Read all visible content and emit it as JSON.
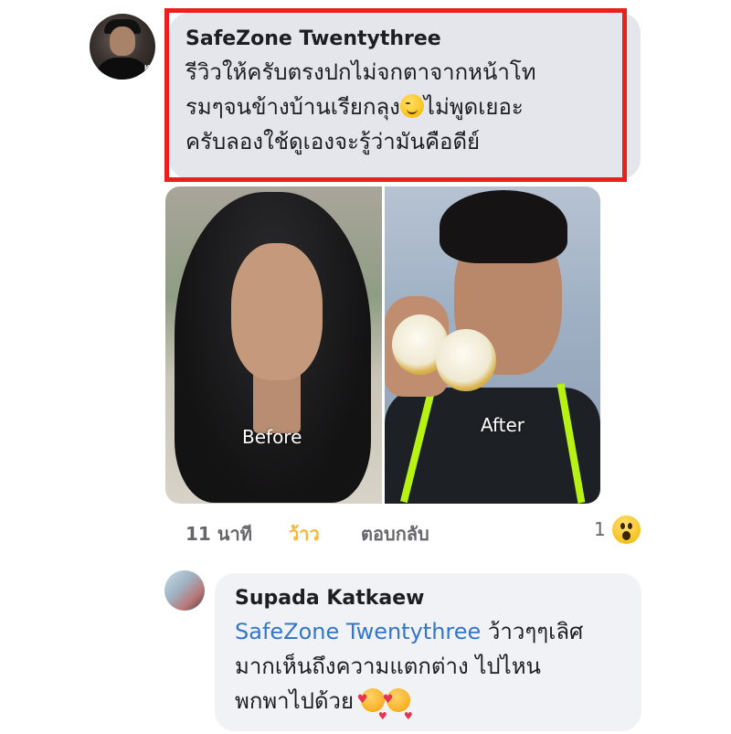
{
  "comment": {
    "author": "SafeZone Twentythree",
    "avatar_tag": "K",
    "lines": [
      "รีวิวให้ครับตรงปกไม่จกตาจากหน้าโท",
      "รมๆจนข้างบ้านเรียกลุง",
      "ไม่พูดเยอะ",
      "ครับลองใช้ดูเองจะรู้ว่ามันคือดีย์"
    ],
    "emoji": "wink-emoji",
    "photos": {
      "before_label": "Before",
      "after_label": "After"
    },
    "meta": {
      "time": "11 นาที",
      "reaction": "ว้าว",
      "reply": "ตอบกลับ",
      "reaction_count": "1",
      "reaction_icon": "wow-icon"
    },
    "highlight_color": "#e8211d"
  },
  "reply": {
    "author": "Supada Katkaew",
    "mention": "SafeZone Twentythree",
    "line1_rest": " ว้าวๆๆเลิศ",
    "line2": "มากเห็นถึงความแตกต่าง ไปไหน",
    "line3": "พกพาไปด้วย ",
    "emoji": "smiling-face-with-hearts-emoji"
  },
  "colors": {
    "bubble": "#e4e6eb",
    "mention": "#3576c8",
    "reaction_active": "#f5b83d",
    "meta_text": "#65676b"
  }
}
